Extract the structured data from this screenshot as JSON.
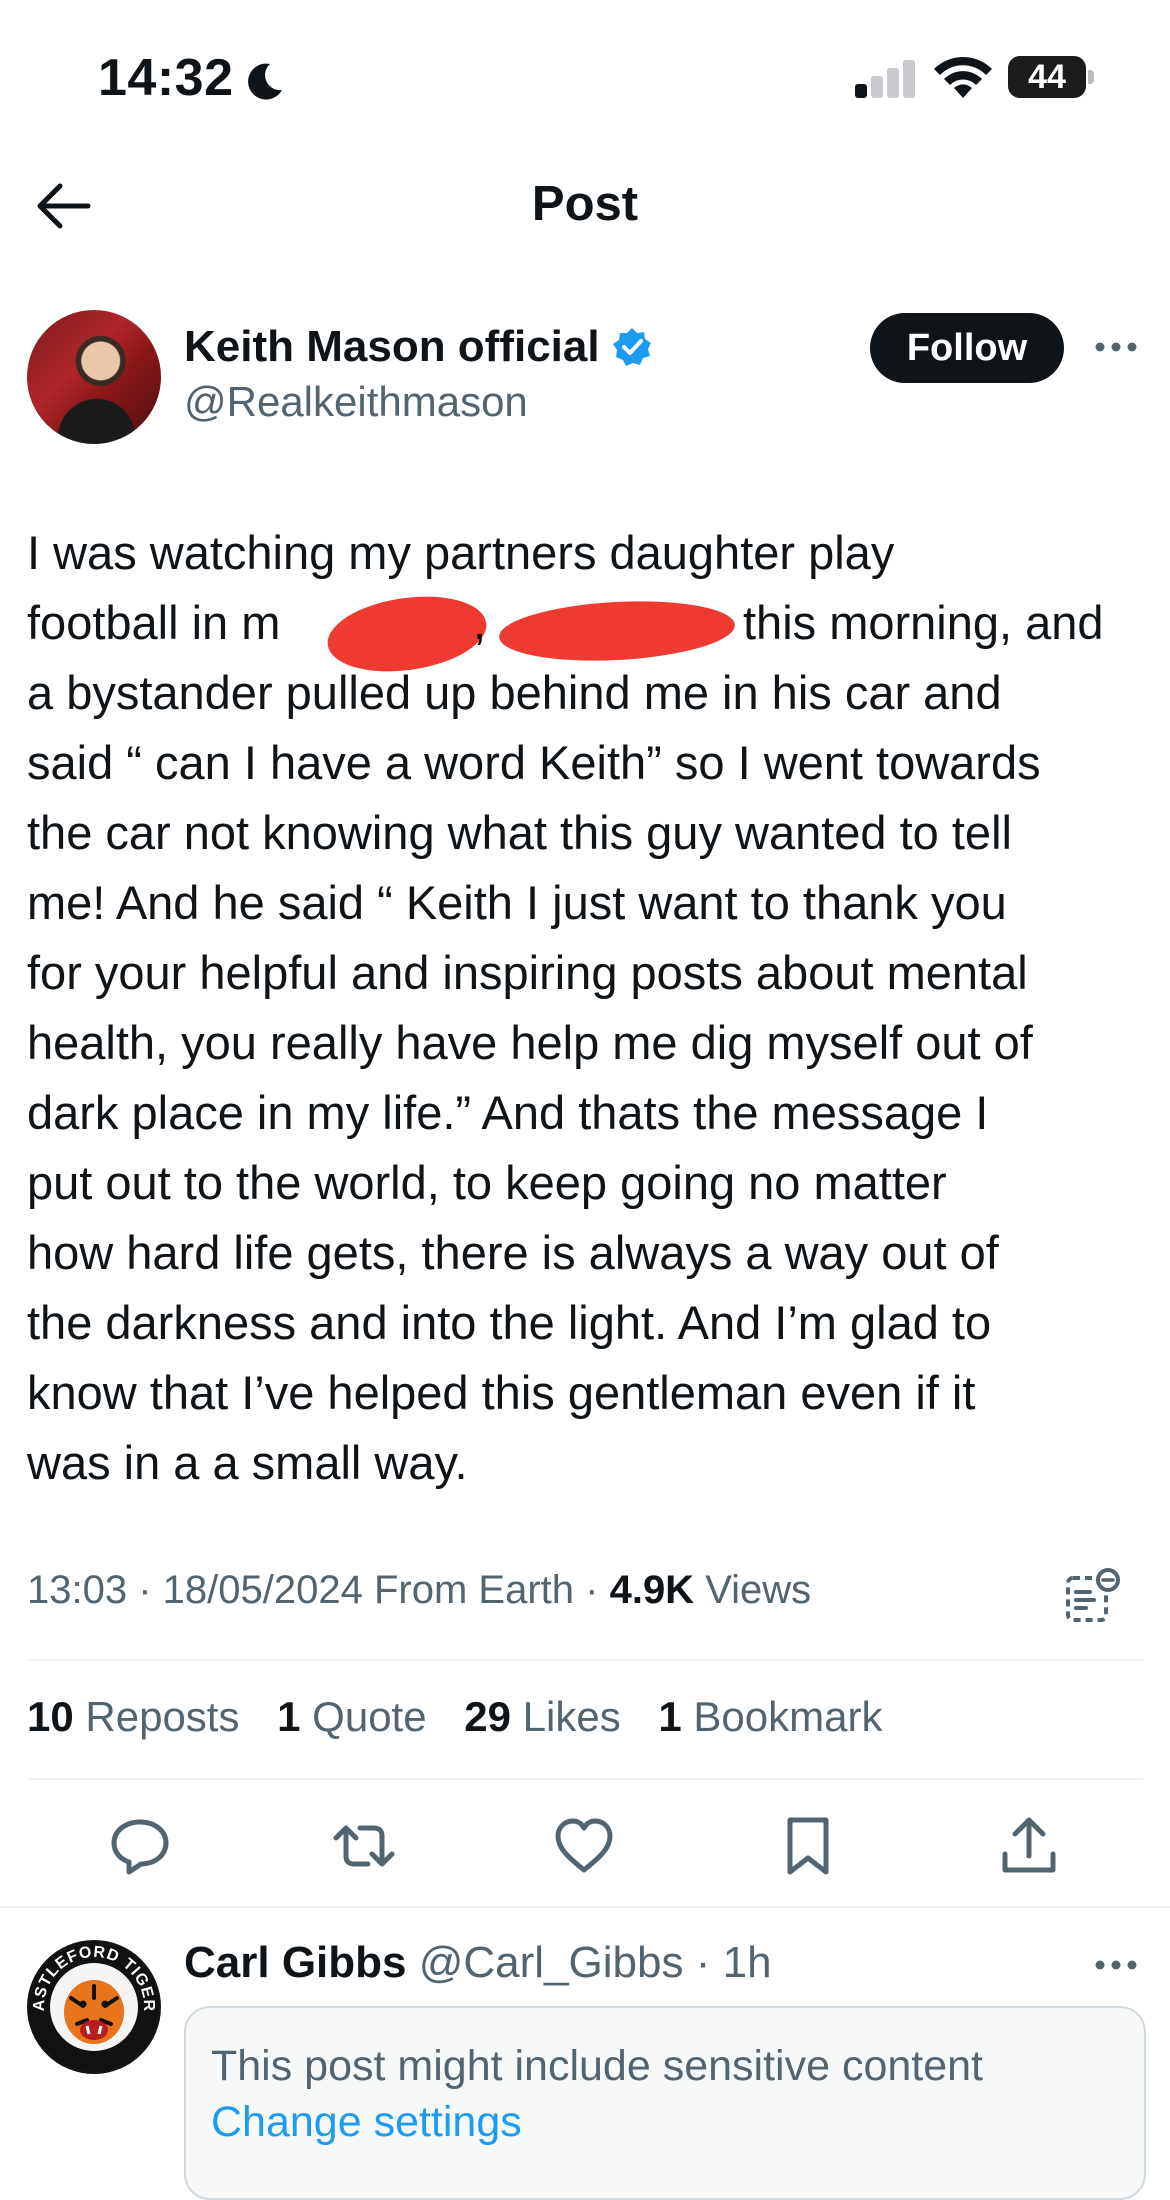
{
  "status_bar": {
    "time": "14:32",
    "battery": "44",
    "icons": [
      "moon-icon",
      "signal-icon",
      "wifi-icon",
      "battery-icon"
    ]
  },
  "header": {
    "title": "Post",
    "back_icon": "arrow-left-icon"
  },
  "author": {
    "name": "Keith Mason official",
    "handle": "@Realkeithmason",
    "verified": true,
    "follow_label": "Follow",
    "more_icon": "more-horizontal-icon"
  },
  "post": {
    "lines": [
      "I was watching my partners daughter play",
      "football in m",
      "a bystander pulled up behind me in his car and",
      "said “ can I have a word Keith” so I went towards",
      "the car not knowing what this guy wanted to tell",
      "me! And he said “ Keith I just want to thank you",
      "for your helpful and inspiring posts about mental",
      "health, you really have help me dig myself out of",
      "dark place in my life.” And thats the message I",
      "put out to the world, to keep going no matter",
      "how hard life gets, there is always a way out of",
      "the darkness and into the light. And I’m glad to",
      "know that I’ve helped this gentleman even if it",
      "was in a a small way."
    ],
    "line2_middle": ",",
    "line2_end": "this morning, and",
    "redaction_color": "#ef3a32"
  },
  "meta": {
    "time": "13:03",
    "date": "18/05/2024",
    "source": "From Earth",
    "views_count": "4.9K",
    "views_label": "Views"
  },
  "counts": {
    "reposts_num": "10",
    "reposts_label": "Reposts",
    "quote_num": "1",
    "quote_label": "Quote",
    "likes_num": "29",
    "likes_label": "Likes",
    "bookmark_num": "1",
    "bookmark_label": "Bookmark"
  },
  "actions": [
    "reply-icon",
    "repost-icon",
    "like-icon",
    "bookmark-icon",
    "share-icon"
  ],
  "reply": {
    "name": "Carl Gibbs",
    "handle": "@Carl_Gibbs",
    "time": "1h",
    "sensitive_text": "This post might include sensitive content",
    "change_settings": "Change settings",
    "avatar_text": "CASTLEFORD TIGERS"
  },
  "colors": {
    "accent": "#1d9bf0",
    "text_primary": "#0f1419",
    "text_secondary": "#536471",
    "divider": "#eff3f4"
  }
}
